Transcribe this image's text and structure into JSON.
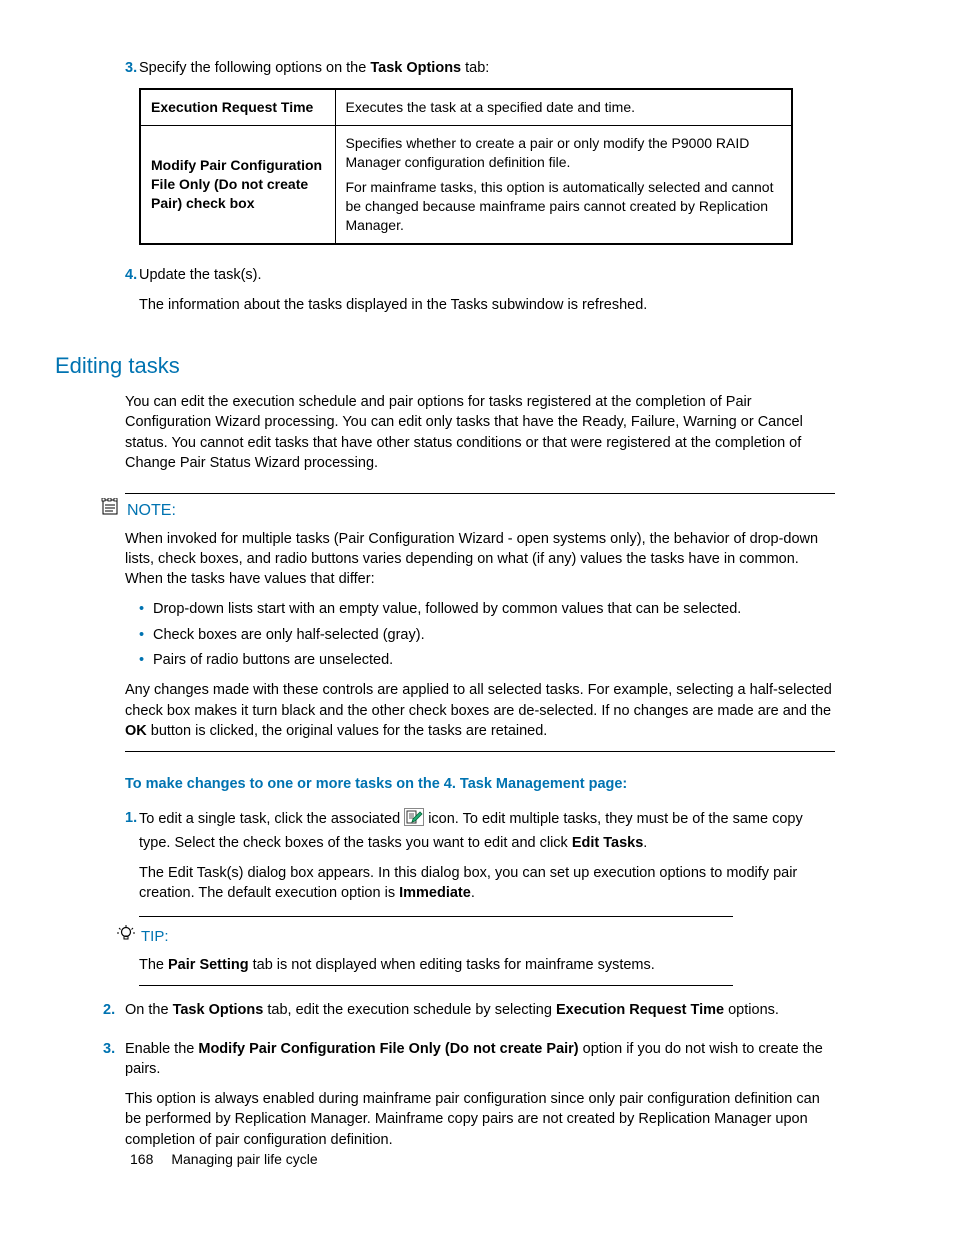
{
  "step3": {
    "num": "3.",
    "intro_a": "Specify the following options on the ",
    "intro_b": "Task Options",
    "intro_c": " tab:"
  },
  "table": {
    "r1c1": "Execution Request Time",
    "r1c2": "Executes the task at a specified date and time.",
    "r2c1": "Modify Pair Configuration File Only (Do not create Pair) check box",
    "r2c2a": "Specifies whether to create a pair or only modify the P9000 RAID Manager configuration definition file.",
    "r2c2b": "For mainframe tasks, this option is automatically selected and cannot be changed because mainframe pairs cannot created by Replication Manager."
  },
  "step4": {
    "num": "4.",
    "line1": "Update the task(s).",
    "line2": "The information about the tasks displayed in the Tasks subwindow is refreshed."
  },
  "section_title": "Editing tasks",
  "section_para": "You can edit the execution schedule and pair options for tasks registered at the completion of Pair Configuration Wizard processing. You can edit only tasks that have the Ready, Failure, Warning or Cancel status. You cannot edit tasks that have other status conditions or that were registered at the completion of Change Pair Status Wizard processing.",
  "note": {
    "title": "NOTE:",
    "p1": "When invoked for multiple tasks (Pair Configuration Wizard - open systems only), the behavior of drop-down lists, check boxes, and radio buttons varies depending on what (if any) values the tasks have in common. When the tasks have values that differ:",
    "b1": "Drop-down lists start with an empty value, followed by common values that can be selected.",
    "b2": "Check boxes are only half-selected (gray).",
    "b3": "Pairs of radio buttons are unselected.",
    "p2a": "Any changes made with these controls are applied to all selected tasks. For example, selecting a half-selected check box makes it turn black and the other check boxes are de-selected. If no changes are made are and the ",
    "p2b": "OK",
    "p2c": " button is clicked, the original values for the tasks are retained."
  },
  "subhead": "To make changes to one or more tasks on the 4. Task Management page:",
  "proc1": {
    "num": "1.",
    "l1a": "To edit a single task, click the associated ",
    "l1b": " icon. To edit multiple tasks, they must be of the same copy type. Select the check boxes of the tasks you want to edit and click ",
    "l1c": "Edit Tasks",
    "l1d": ".",
    "l2a": "The Edit Task(s) dialog box appears. In this dialog box, you can set up execution options to modify pair creation. The default execution option is ",
    "l2b": "Immediate",
    "l2c": "."
  },
  "tip": {
    "title": "TIP:",
    "a": "The ",
    "b": "Pair Setting",
    "c": " tab is not displayed when editing tasks for mainframe systems."
  },
  "proc2": {
    "num": "2.",
    "a": "On the ",
    "b": "Task Options",
    "c": " tab, edit the execution schedule by selecting ",
    "d": "Execution Request Time",
    "e": " options."
  },
  "proc3": {
    "num": "3.",
    "a": "Enable the ",
    "b": "Modify Pair Configuration File Only (Do not create Pair)",
    "c": " option if you do not wish to create the pairs.",
    "p2": "This option is always enabled during mainframe pair configuration since only pair configuration definition can be performed by Replication Manager. Mainframe copy pairs are not created by Replication Manager upon completion of pair configuration definition."
  },
  "footer": {
    "page": "168",
    "title": "Managing pair life cycle"
  }
}
